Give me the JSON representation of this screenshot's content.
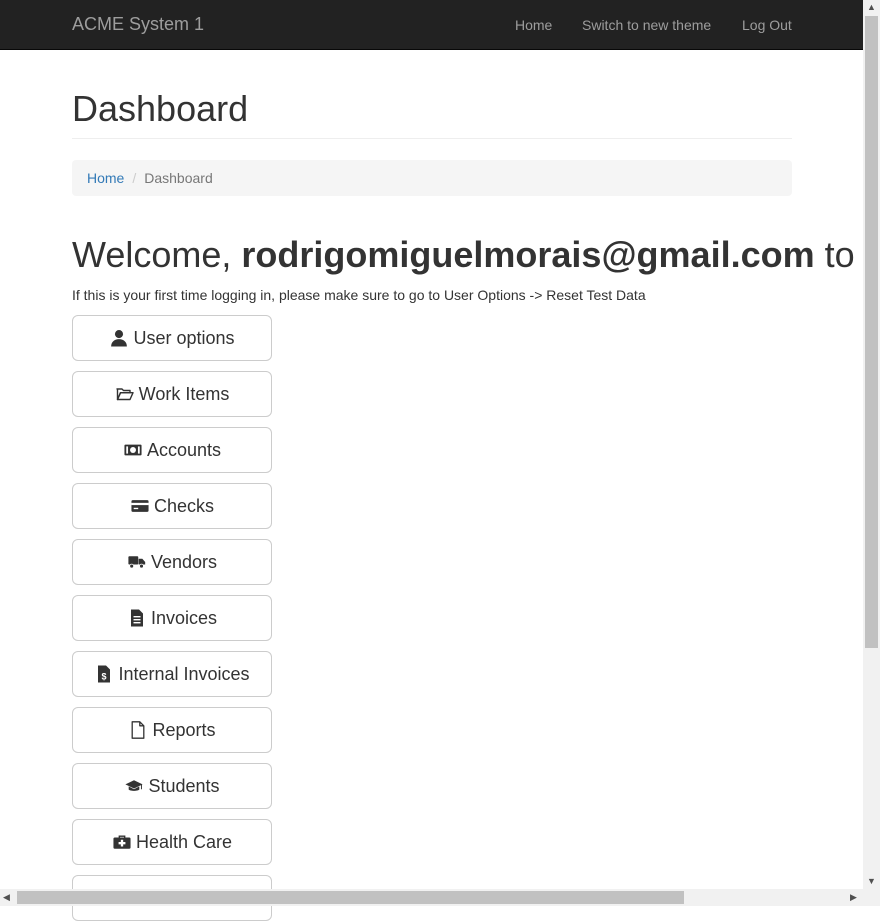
{
  "navbar": {
    "brand": "ACME System 1",
    "links": [
      "Home",
      "Switch to new theme",
      "Log Out"
    ]
  },
  "page": {
    "title": "Dashboard",
    "breadcrumb": {
      "home": "Home",
      "separator": "/",
      "current": "Dashboard"
    },
    "welcome_prefix": "Welcome, ",
    "welcome_user": "rodrigomiguelmorais@gmail.com",
    "welcome_suffix": " to",
    "hint": "If this is your first time logging in, please make sure to go to User Options -> Reset Test Data"
  },
  "menu": [
    {
      "label": "User options",
      "icon": "user-icon"
    },
    {
      "label": "Work Items",
      "icon": "folder-open-icon"
    },
    {
      "label": "Accounts",
      "icon": "money-icon"
    },
    {
      "label": "Checks",
      "icon": "credit-card-icon"
    },
    {
      "label": "Vendors",
      "icon": "truck-icon"
    },
    {
      "label": "Invoices",
      "icon": "file-text-icon"
    },
    {
      "label": "Internal Invoices",
      "icon": "file-invoice-dollar-icon"
    },
    {
      "label": "Reports",
      "icon": "file-icon"
    },
    {
      "label": "Students",
      "icon": "graduation-cap-icon"
    },
    {
      "label": "Health Care",
      "icon": "medkit-icon"
    }
  ]
}
